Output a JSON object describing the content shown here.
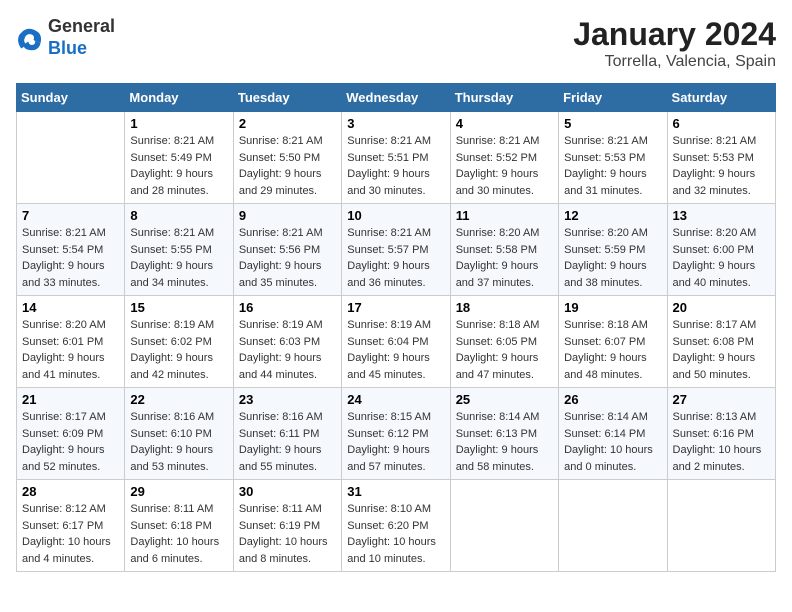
{
  "logo": {
    "general": "General",
    "blue": "Blue"
  },
  "title": "January 2024",
  "subtitle": "Torrella, Valencia, Spain",
  "weekdays": [
    "Sunday",
    "Monday",
    "Tuesday",
    "Wednesday",
    "Thursday",
    "Friday",
    "Saturday"
  ],
  "weeks": [
    [
      {
        "day": "",
        "sunrise": "",
        "sunset": "",
        "daylight": ""
      },
      {
        "day": "1",
        "sunrise": "Sunrise: 8:21 AM",
        "sunset": "Sunset: 5:49 PM",
        "daylight": "Daylight: 9 hours and 28 minutes."
      },
      {
        "day": "2",
        "sunrise": "Sunrise: 8:21 AM",
        "sunset": "Sunset: 5:50 PM",
        "daylight": "Daylight: 9 hours and 29 minutes."
      },
      {
        "day": "3",
        "sunrise": "Sunrise: 8:21 AM",
        "sunset": "Sunset: 5:51 PM",
        "daylight": "Daylight: 9 hours and 30 minutes."
      },
      {
        "day": "4",
        "sunrise": "Sunrise: 8:21 AM",
        "sunset": "Sunset: 5:52 PM",
        "daylight": "Daylight: 9 hours and 30 minutes."
      },
      {
        "day": "5",
        "sunrise": "Sunrise: 8:21 AM",
        "sunset": "Sunset: 5:53 PM",
        "daylight": "Daylight: 9 hours and 31 minutes."
      },
      {
        "day": "6",
        "sunrise": "Sunrise: 8:21 AM",
        "sunset": "Sunset: 5:53 PM",
        "daylight": "Daylight: 9 hours and 32 minutes."
      }
    ],
    [
      {
        "day": "7",
        "sunrise": "Sunrise: 8:21 AM",
        "sunset": "Sunset: 5:54 PM",
        "daylight": "Daylight: 9 hours and 33 minutes."
      },
      {
        "day": "8",
        "sunrise": "Sunrise: 8:21 AM",
        "sunset": "Sunset: 5:55 PM",
        "daylight": "Daylight: 9 hours and 34 minutes."
      },
      {
        "day": "9",
        "sunrise": "Sunrise: 8:21 AM",
        "sunset": "Sunset: 5:56 PM",
        "daylight": "Daylight: 9 hours and 35 minutes."
      },
      {
        "day": "10",
        "sunrise": "Sunrise: 8:21 AM",
        "sunset": "Sunset: 5:57 PM",
        "daylight": "Daylight: 9 hours and 36 minutes."
      },
      {
        "day": "11",
        "sunrise": "Sunrise: 8:20 AM",
        "sunset": "Sunset: 5:58 PM",
        "daylight": "Daylight: 9 hours and 37 minutes."
      },
      {
        "day": "12",
        "sunrise": "Sunrise: 8:20 AM",
        "sunset": "Sunset: 5:59 PM",
        "daylight": "Daylight: 9 hours and 38 minutes."
      },
      {
        "day": "13",
        "sunrise": "Sunrise: 8:20 AM",
        "sunset": "Sunset: 6:00 PM",
        "daylight": "Daylight: 9 hours and 40 minutes."
      }
    ],
    [
      {
        "day": "14",
        "sunrise": "Sunrise: 8:20 AM",
        "sunset": "Sunset: 6:01 PM",
        "daylight": "Daylight: 9 hours and 41 minutes."
      },
      {
        "day": "15",
        "sunrise": "Sunrise: 8:19 AM",
        "sunset": "Sunset: 6:02 PM",
        "daylight": "Daylight: 9 hours and 42 minutes."
      },
      {
        "day": "16",
        "sunrise": "Sunrise: 8:19 AM",
        "sunset": "Sunset: 6:03 PM",
        "daylight": "Daylight: 9 hours and 44 minutes."
      },
      {
        "day": "17",
        "sunrise": "Sunrise: 8:19 AM",
        "sunset": "Sunset: 6:04 PM",
        "daylight": "Daylight: 9 hours and 45 minutes."
      },
      {
        "day": "18",
        "sunrise": "Sunrise: 8:18 AM",
        "sunset": "Sunset: 6:05 PM",
        "daylight": "Daylight: 9 hours and 47 minutes."
      },
      {
        "day": "19",
        "sunrise": "Sunrise: 8:18 AM",
        "sunset": "Sunset: 6:07 PM",
        "daylight": "Daylight: 9 hours and 48 minutes."
      },
      {
        "day": "20",
        "sunrise": "Sunrise: 8:17 AM",
        "sunset": "Sunset: 6:08 PM",
        "daylight": "Daylight: 9 hours and 50 minutes."
      }
    ],
    [
      {
        "day": "21",
        "sunrise": "Sunrise: 8:17 AM",
        "sunset": "Sunset: 6:09 PM",
        "daylight": "Daylight: 9 hours and 52 minutes."
      },
      {
        "day": "22",
        "sunrise": "Sunrise: 8:16 AM",
        "sunset": "Sunset: 6:10 PM",
        "daylight": "Daylight: 9 hours and 53 minutes."
      },
      {
        "day": "23",
        "sunrise": "Sunrise: 8:16 AM",
        "sunset": "Sunset: 6:11 PM",
        "daylight": "Daylight: 9 hours and 55 minutes."
      },
      {
        "day": "24",
        "sunrise": "Sunrise: 8:15 AM",
        "sunset": "Sunset: 6:12 PM",
        "daylight": "Daylight: 9 hours and 57 minutes."
      },
      {
        "day": "25",
        "sunrise": "Sunrise: 8:14 AM",
        "sunset": "Sunset: 6:13 PM",
        "daylight": "Daylight: 9 hours and 58 minutes."
      },
      {
        "day": "26",
        "sunrise": "Sunrise: 8:14 AM",
        "sunset": "Sunset: 6:14 PM",
        "daylight": "Daylight: 10 hours and 0 minutes."
      },
      {
        "day": "27",
        "sunrise": "Sunrise: 8:13 AM",
        "sunset": "Sunset: 6:16 PM",
        "daylight": "Daylight: 10 hours and 2 minutes."
      }
    ],
    [
      {
        "day": "28",
        "sunrise": "Sunrise: 8:12 AM",
        "sunset": "Sunset: 6:17 PM",
        "daylight": "Daylight: 10 hours and 4 minutes."
      },
      {
        "day": "29",
        "sunrise": "Sunrise: 8:11 AM",
        "sunset": "Sunset: 6:18 PM",
        "daylight": "Daylight: 10 hours and 6 minutes."
      },
      {
        "day": "30",
        "sunrise": "Sunrise: 8:11 AM",
        "sunset": "Sunset: 6:19 PM",
        "daylight": "Daylight: 10 hours and 8 minutes."
      },
      {
        "day": "31",
        "sunrise": "Sunrise: 8:10 AM",
        "sunset": "Sunset: 6:20 PM",
        "daylight": "Daylight: 10 hours and 10 minutes."
      },
      {
        "day": "",
        "sunrise": "",
        "sunset": "",
        "daylight": ""
      },
      {
        "day": "",
        "sunrise": "",
        "sunset": "",
        "daylight": ""
      },
      {
        "day": "",
        "sunrise": "",
        "sunset": "",
        "daylight": ""
      }
    ]
  ]
}
